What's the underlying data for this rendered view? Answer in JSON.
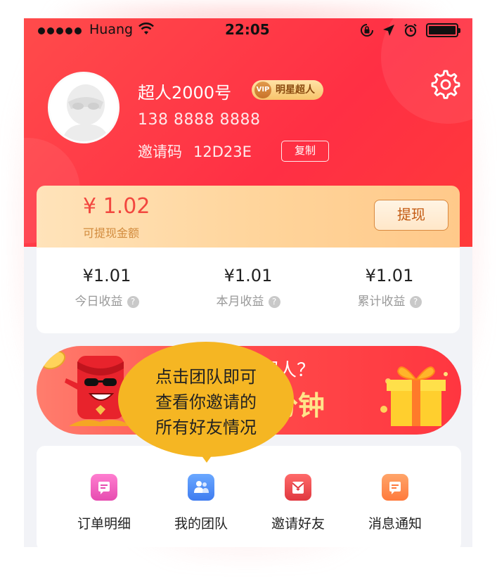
{
  "status_bar": {
    "carrier": "Huang",
    "time": "22:05"
  },
  "profile": {
    "username": "超人2000号",
    "vip_badge_icon_text": "VIP",
    "vip_badge_label": "明星超人",
    "phone": "138 8888 8888",
    "invite_label": "邀请码",
    "invite_code": "12D23E",
    "copy_button": "复制"
  },
  "earnings": {
    "withdrawable_amount": "¥ 1.02",
    "withdrawable_label": "可提现金额",
    "withdraw_button": "提现",
    "stats": [
      {
        "value": "¥1.01",
        "label": "今日收益"
      },
      {
        "value": "¥1.01",
        "label": "本月收益"
      },
      {
        "value": "¥1.01",
        "label": "累计收益"
      }
    ],
    "help_glyph": "?"
  },
  "banner": {
    "line1": "超人？",
    "line2": "分钟"
  },
  "tooltip": {
    "line1": "点击团队即可",
    "line2": "查看你邀请的",
    "line3": "所有好友情况"
  },
  "menu": {
    "items": [
      {
        "label": "订单明细",
        "icon": "order-icon",
        "color": "#f35fb0"
      },
      {
        "label": "我的团队",
        "icon": "team-icon",
        "color": "#4f8ef7"
      },
      {
        "label": "邀请好友",
        "icon": "invite-icon",
        "color": "#ef4a55"
      },
      {
        "label": "消息通知",
        "icon": "message-icon",
        "color": "#ff8a4e"
      }
    ]
  },
  "colors": {
    "header_red": "#ff3444",
    "accent_gold": "#f5b623",
    "amount_red": "#f2473f"
  }
}
